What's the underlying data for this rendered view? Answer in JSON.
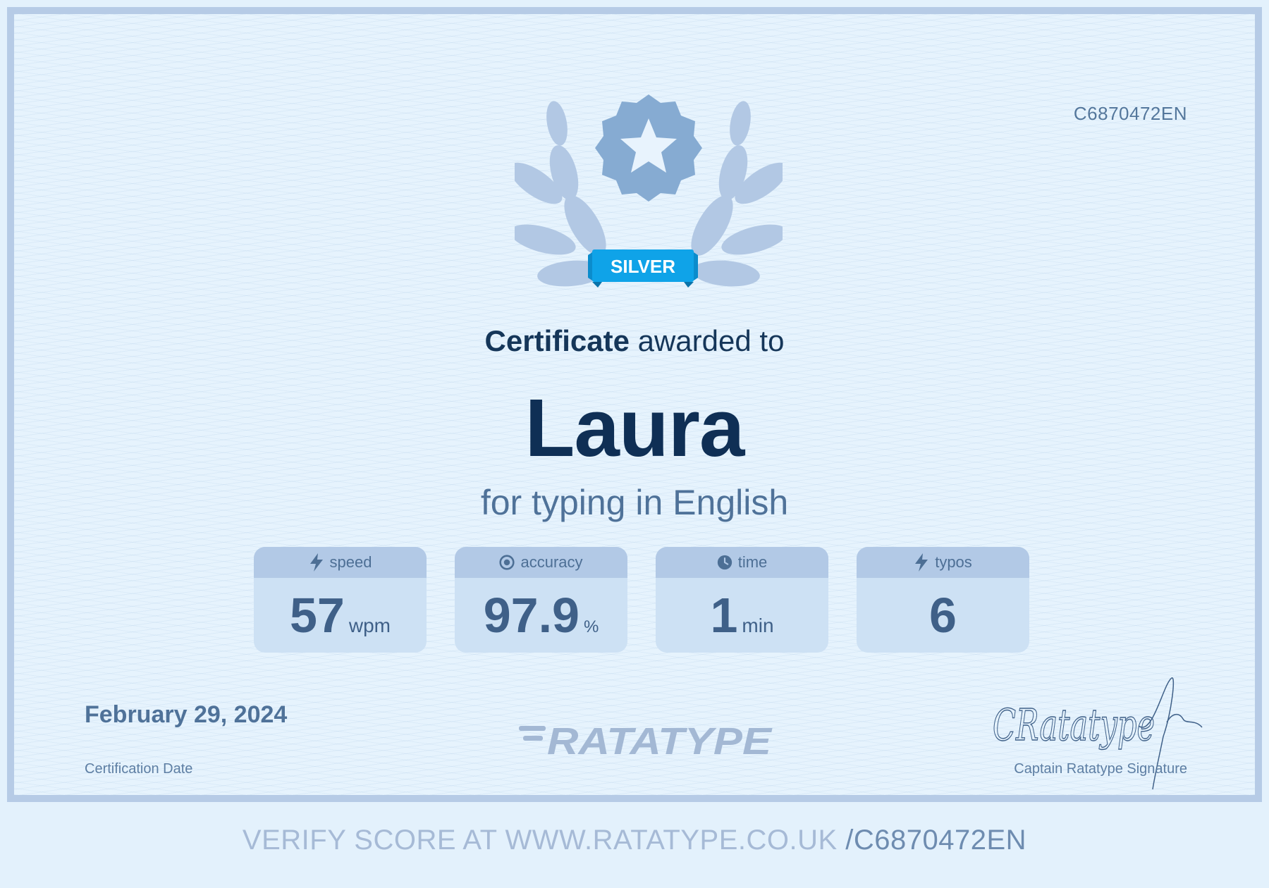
{
  "certificate": {
    "id": "C6870472EN",
    "badge_label": "SILVER",
    "headline_strong": "Certificate",
    "headline_rest": " awarded to",
    "recipient": "Laura",
    "subline": "for typing in English",
    "date": "February 29, 2024",
    "date_label": "Certification Date",
    "brand": "RATATYPE",
    "signature_text": "CRatatype",
    "signature_label": "Captain Ratatype Signature"
  },
  "stats": {
    "speed": {
      "label": "speed",
      "value": "57",
      "unit": "wpm",
      "icon": "lightning-icon"
    },
    "accuracy": {
      "label": "accuracy",
      "value": "97.9",
      "unit": "%",
      "icon": "target-icon"
    },
    "time": {
      "label": "time",
      "value": "1",
      "unit": "min",
      "icon": "clock-icon"
    },
    "typos": {
      "label": "typos",
      "value": "6",
      "unit": "",
      "icon": "lightning-icon"
    }
  },
  "footer": {
    "verify_text": "VERIFY SCORE AT WWW.RATATYPE.CO.UK ",
    "verify_code": "/C6870472EN"
  },
  "colors": {
    "background": "#e6f3fd",
    "border": "#b6cbe6",
    "badge": "#0fa3e8",
    "title": "#0f2f55",
    "muted": "#4f7299"
  }
}
